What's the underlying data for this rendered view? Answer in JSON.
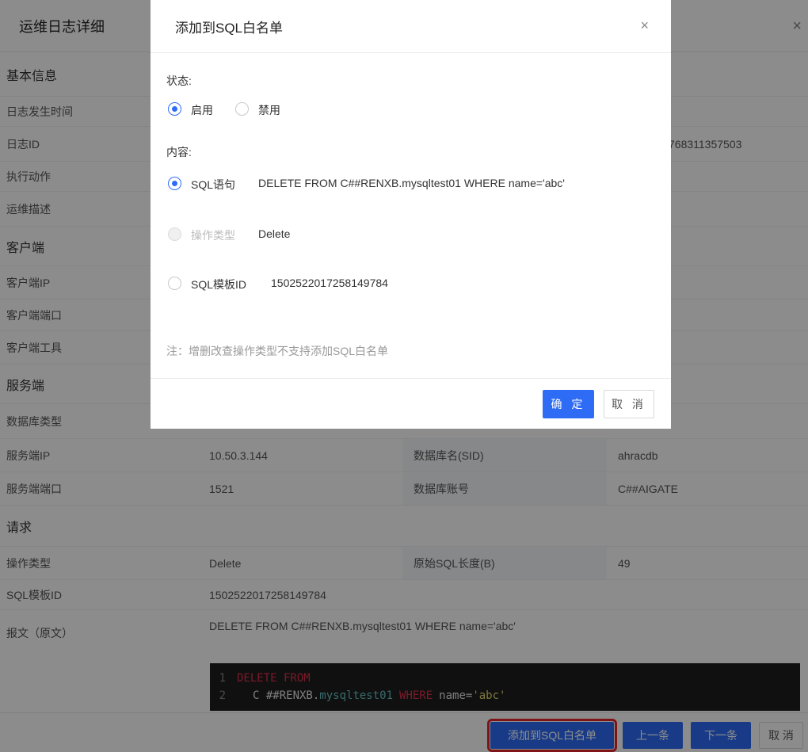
{
  "drawer": {
    "title": "运维日志详细",
    "close_icon": "×",
    "rows": {
      "basic": "基本信息",
      "log_time": "日志发生时间",
      "log_id": "日志ID",
      "log_id_value": "768311357503",
      "action": "执行动作",
      "description": "运维描述",
      "client": "客户端",
      "client_ip": "客户端IP",
      "client_port": "客户端端口",
      "client_tool": "客户端工具",
      "server": "服务端",
      "db_type": "数据库类型",
      "server_ip": "服务端IP",
      "server_ip_value": "10.50.3.144",
      "db_name_label": "数据库名(SID)",
      "db_name_value": "ahracdb",
      "server_port": "服务端端口",
      "server_port_value": "1521",
      "db_account_label": "数据库账号",
      "db_account_value": "C##AIGATE",
      "request": "请求",
      "op_type": "操作类型",
      "op_type_value": "Delete",
      "sql_len_label": "原始SQL长度(B)",
      "sql_len_value": "49",
      "sql_tpl_id": "SQL模板ID",
      "sql_tpl_id_value": "1502522017258149784",
      "message": "报文（原文）",
      "message_value": "DELETE FROM C##RENXB.mysqltest01 WHERE name='abc'"
    },
    "code": {
      "line1_no": "1",
      "line1_kw": "DELETE FROM",
      "line2_no": "2",
      "line2_a": "C ##RENXB.",
      "line2_b": "mysqltest01",
      "line2_kw": "WHERE",
      "line2_c": "name=",
      "line2_str": "'abc'"
    },
    "footer": {
      "add_whitelist": "添加到SQL白名单",
      "prev": "上一条",
      "next": "下一条",
      "cancel": "取 消"
    }
  },
  "modal": {
    "title": "添加到SQL白名单",
    "close_icon": "×",
    "status_label": "状态:",
    "status_options": [
      "启用",
      "禁用"
    ],
    "status_selected": "启用",
    "content_label": "内容:",
    "content_options": {
      "sql": {
        "label": "SQL语句",
        "value": "DELETE FROM C##RENXB.mysqltest01 WHERE name='abc'"
      },
      "op_type": {
        "label": "操作类型",
        "value": "Delete"
      },
      "tpl": {
        "label": "SQL模板ID",
        "value": "1502522017258149784"
      }
    },
    "note": "注：增删改查操作类型不支持添加SQL白名单",
    "ok": "确 定",
    "cancel": "取 消"
  },
  "colors": {
    "primary": "#2f6cf6",
    "highlight": "#e8262b"
  }
}
